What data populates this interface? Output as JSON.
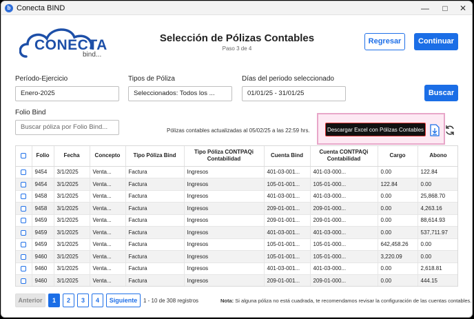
{
  "window": {
    "title": "Conecta BIND"
  },
  "logo": {
    "text": "CONECTA",
    "sub": "bind..."
  },
  "header": {
    "title": "Selección de Pólizas Contables",
    "step": "Paso 3 de 4",
    "back_label": "Regresar",
    "continue_label": "Continuar"
  },
  "filters": {
    "periodo_label": "Período-Ejercicio",
    "periodo_value": "Enero-2025",
    "tipos_label": "Tipos de Póliza",
    "tipos_value": "Seleccionados: Todos los ...",
    "dias_label": "Días del periodo seleccionado",
    "dias_value": "01/01/25 - 31/01/25",
    "search_label": "Buscar",
    "folio_label": "Folio Bind",
    "folio_placeholder": "Buscar póliza por Folio Bind..."
  },
  "update_msg": "Pólizas contables actualizadas al 05/02/25 a las 22:59 hrs.",
  "tooltip": "Descargar Excel con Pólizas Contables",
  "table": {
    "headers": [
      "Folio",
      "Fecha",
      "Concepto",
      "Tipo Póliza Bind",
      "Tipo Póliza CONTPAQi Contabilidad",
      "Cuenta Bind",
      "Cuenta CONTPAQi Contabilidad",
      "Cargo",
      "Abono"
    ],
    "rows": [
      [
        "9454",
        "3/1/2025",
        "Venta...",
        "Factura",
        "Ingresos",
        "401-03-001...",
        "401-03-000...",
        "0.00",
        "122.84"
      ],
      [
        "9454",
        "3/1/2025",
        "Venta...",
        "Factura",
        "Ingresos",
        "105-01-001...",
        "105-01-000...",
        "122.84",
        "0.00"
      ],
      [
        "9458",
        "3/1/2025",
        "Venta...",
        "Factura",
        "Ingresos",
        "401-03-001...",
        "401-03-000...",
        "0.00",
        "25,868.70"
      ],
      [
        "9458",
        "3/1/2025",
        "Venta...",
        "Factura",
        "Ingresos",
        "209-01-001...",
        "209-01-000...",
        "0.00",
        "4,263.16"
      ],
      [
        "9459",
        "3/1/2025",
        "Venta...",
        "Factura",
        "Ingresos",
        "209-01-001...",
        "209-01-000...",
        "0.00",
        "88,614.93"
      ],
      [
        "9459",
        "3/1/2025",
        "Venta...",
        "Factura",
        "Ingresos",
        "401-03-001...",
        "401-03-000...",
        "0.00",
        "537,711.97"
      ],
      [
        "9459",
        "3/1/2025",
        "Venta...",
        "Factura",
        "Ingresos",
        "105-01-001...",
        "105-01-000...",
        "642,458.26",
        "0.00"
      ],
      [
        "9460",
        "3/1/2025",
        "Venta...",
        "Factura",
        "Ingresos",
        "105-01-001...",
        "105-01-000...",
        "3,220.09",
        "0.00"
      ],
      [
        "9460",
        "3/1/2025",
        "Venta...",
        "Factura",
        "Ingresos",
        "401-03-001...",
        "401-03-000...",
        "0.00",
        "2,618.81"
      ],
      [
        "9460",
        "3/1/2025",
        "Venta...",
        "Factura",
        "Ingresos",
        "209-01-001...",
        "209-01-000...",
        "0.00",
        "444.15"
      ]
    ]
  },
  "pager": {
    "prev_label": "Anterior",
    "pages": [
      "1",
      "2",
      "3",
      "4"
    ],
    "next_label": "Siguiente",
    "range_text": "1 - 10 de 308 registros"
  },
  "note": {
    "bold": "Nota:",
    "text": "Si alguna póliza no está cuadrada, te recomendamos revisar la configuración de las cuentas contables."
  },
  "colors": {
    "accent": "#1b6ee6",
    "logo": "#1d4fa8",
    "tooltip_highlight": "#fde9f3"
  }
}
